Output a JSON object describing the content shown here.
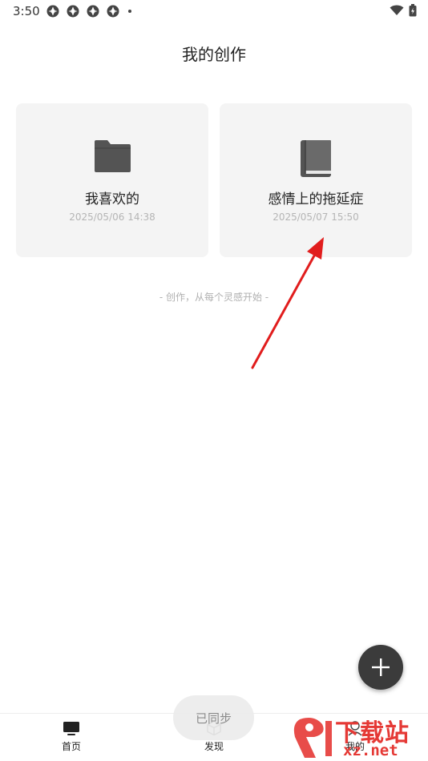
{
  "status_bar": {
    "time": "3:50",
    "notification_icons": [
      "app-notification-icon",
      "app-notification-icon",
      "app-notification-icon",
      "app-notification-icon"
    ],
    "right_icons": [
      "wifi-icon",
      "battery-icon"
    ]
  },
  "header": {
    "title": "我的创作"
  },
  "cards": [
    {
      "title": "我喜欢的",
      "date": "2025/05/06 14:38",
      "icon": "folder-icon"
    },
    {
      "title": "感情上的拖延症",
      "date": "2025/05/07 15:50",
      "icon": "book-icon"
    }
  ],
  "hint": "- 创作，从每个灵感开始 -",
  "fab": {
    "icon": "plus-icon"
  },
  "sync_pill": {
    "label": "已同步"
  },
  "bottom_nav": {
    "items": [
      {
        "label": "首页",
        "icon": "home-tv-icon"
      },
      {
        "label": "发现",
        "icon": "cube-icon"
      },
      {
        "label": "我的",
        "icon": "profile-icon"
      }
    ]
  },
  "watermark": {
    "brand": "下载站",
    "url": "xz.net"
  },
  "colors": {
    "card_bg": "#f4f4f4",
    "fab_bg": "#3b3b3b",
    "icon_gray": "#545454",
    "annotation_red": "#e11d1d"
  }
}
